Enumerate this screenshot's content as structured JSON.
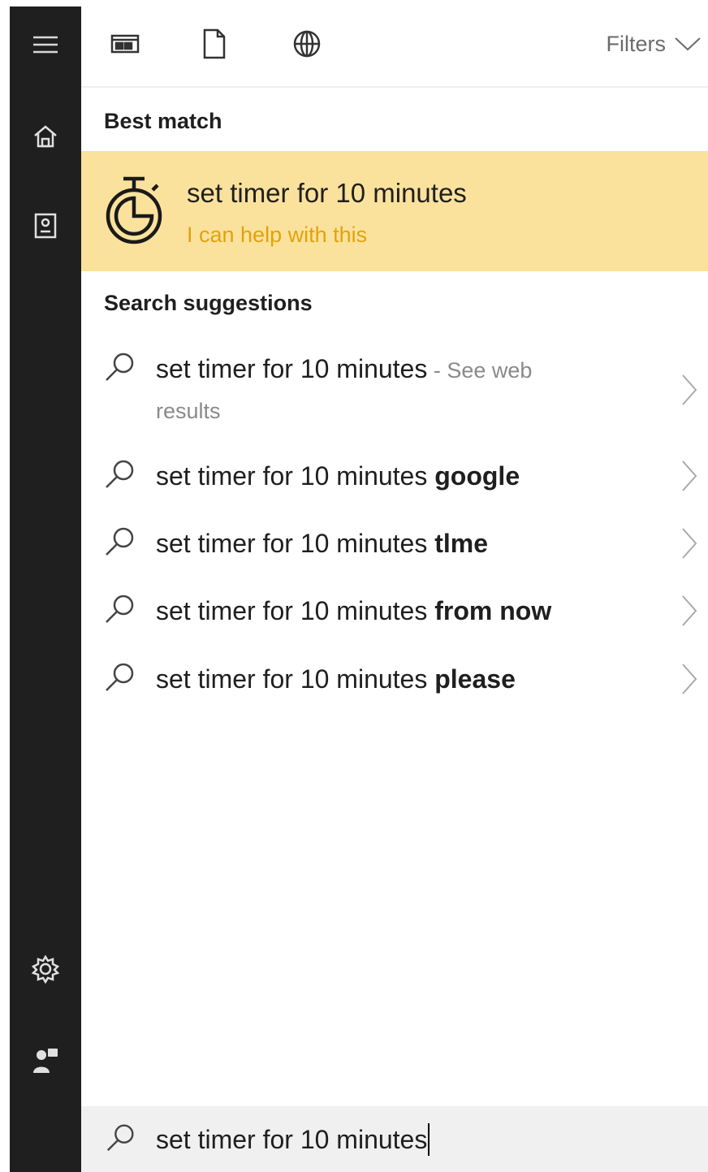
{
  "colors": {
    "sidebar_bg": "#1f1f1f",
    "best_match_bg": "#fbe29c",
    "best_match_subtitle": "#e2a20b",
    "searchbar_bg": "#f0f0f0"
  },
  "sidebar": {
    "items": [
      {
        "icon": "hamburger-menu-icon"
      },
      {
        "icon": "home-icon"
      },
      {
        "icon": "notebook-icon"
      },
      {
        "icon": "gear-icon"
      },
      {
        "icon": "feedback-icon"
      }
    ]
  },
  "toolbar": {
    "scope_icons": [
      "apps-icon",
      "documents-icon",
      "web-globe-icon"
    ],
    "filters_label": "Filters"
  },
  "best_match": {
    "section_label": "Best match",
    "title": "set timer for 10 minutes",
    "subtitle": "I can help with this",
    "icon": "stopwatch-icon"
  },
  "suggestions": {
    "section_label": "Search suggestions",
    "items": [
      {
        "prefix": "set timer for 10 minutes",
        "bold": "",
        "hint": " - See web",
        "hint2": "results"
      },
      {
        "prefix": "set timer for 10 minutes ",
        "bold": "google",
        "hint": "",
        "hint2": ""
      },
      {
        "prefix": "set timer for 10 minutes ",
        "bold": "tlme",
        "hint": "",
        "hint2": ""
      },
      {
        "prefix": "set timer for 10 minutes ",
        "bold": "from now",
        "hint": "",
        "hint2": ""
      },
      {
        "prefix": "set timer for 10 minutes ",
        "bold": "please",
        "hint": "",
        "hint2": ""
      }
    ]
  },
  "search": {
    "value": "set timer for 10 minutes"
  }
}
